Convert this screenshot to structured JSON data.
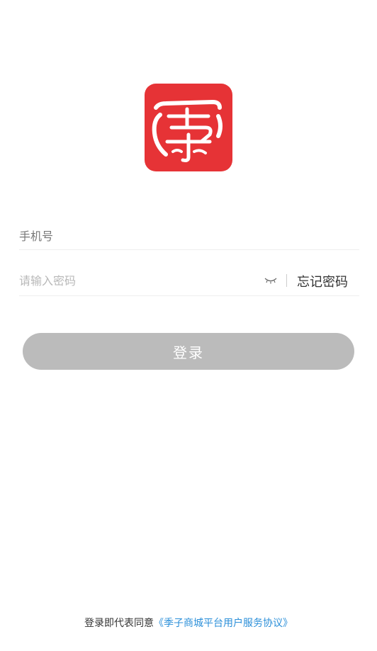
{
  "app": {
    "logo_icon": "ji-zi-brand-logo-icon",
    "logo_color": "#e63336"
  },
  "form": {
    "phone": {
      "value": "",
      "placeholder": "手机号"
    },
    "password": {
      "value": "",
      "placeholder": "请输入密码",
      "toggle_icon": "eye-closed-icon"
    },
    "forgot_password": "忘记密码",
    "login_button": "登录",
    "login_button_color": "#bbbbbb"
  },
  "agreement": {
    "prefix": "登录即代表同意",
    "link": "《季子商城平台用户服务协议》",
    "link_color": "#2b8fd9"
  }
}
